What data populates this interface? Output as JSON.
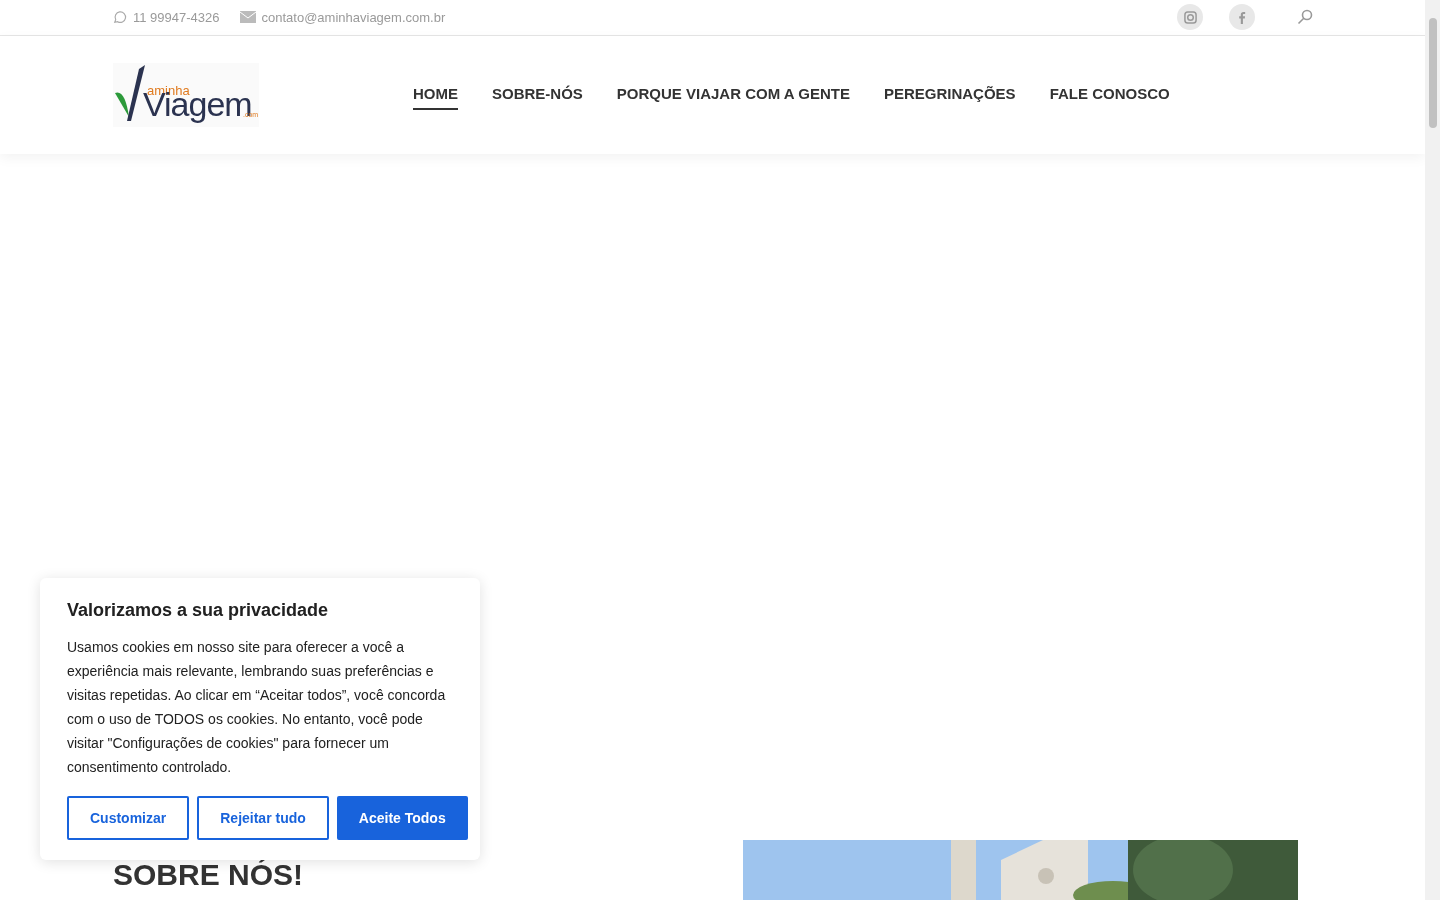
{
  "topbar": {
    "phone": "11 99947-4326",
    "email": "contato@aminhaviagem.com.br"
  },
  "logo": {
    "small": "aminha",
    "main": "Viagem",
    "suffix": ".com"
  },
  "nav": [
    {
      "label": "HOME",
      "selected": true
    },
    {
      "label": "SOBRE-NÓS",
      "selected": false
    },
    {
      "label": "PORQUE VIAJAR COM A GENTE",
      "selected": false
    },
    {
      "label": "PEREGRINAÇÕES",
      "selected": false
    },
    {
      "label": "FALE CONOSCO",
      "selected": false
    }
  ],
  "section": {
    "heading": "SOBRE NÓS!"
  },
  "cookie_banner": {
    "title": "Valorizamos a sua privacidade",
    "text": "Usamos cookies em nosso site para oferecer a você a experiência mais relevante, lembrando suas preferências e visitas repetidas. Ao clicar em “Aceitar todos”, você concorda com o uso de TODOS os cookies. No entanto, você pode visitar \"Configurações de cookies\" para fornecer um consentimento controlado.",
    "buttons": [
      {
        "label": "Customizar",
        "kind": "outline"
      },
      {
        "label": "Rejeitar tudo",
        "kind": "outline"
      },
      {
        "label": "Aceite Todos",
        "kind": "primary"
      }
    ]
  }
}
